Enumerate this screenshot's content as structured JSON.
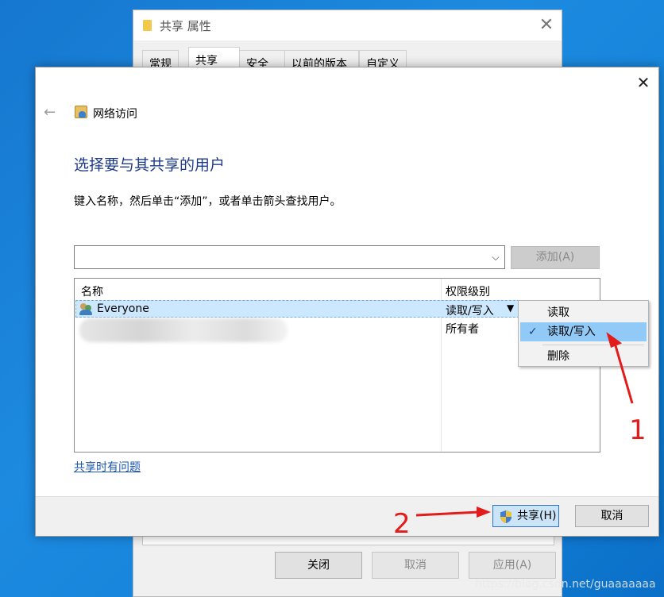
{
  "props_window": {
    "title": "共享 属性",
    "close": "✕",
    "tabs": [
      "常规",
      "共享",
      "安全",
      "以前的版本",
      "自定义"
    ],
    "buttons": {
      "close": "关闭",
      "cancel": "取消",
      "apply": "应用(A)"
    }
  },
  "dialog": {
    "close": "✕",
    "back": "←",
    "caption": "网络访问",
    "heading": "选择要与其共享的用户",
    "instruction": "键入名称，然后单击“添加”，或者单击箭头查找用户。",
    "add_button": "添加(A)",
    "combo_caret": "⌵",
    "columns": {
      "name": "名称",
      "permission": "权限级别"
    },
    "rows": [
      {
        "name": "Everyone",
        "permission": "读取/写入",
        "dropdown": "▼"
      },
      {
        "name": "",
        "permission": "所有者"
      }
    ],
    "help_link": "共享时有问题",
    "share_button": "共享(H)",
    "cancel_button": "取消"
  },
  "context_menu": {
    "items": [
      "读取",
      "读取/写入",
      "删除"
    ],
    "checked": "✓"
  },
  "annotations": {
    "one": "1",
    "two": "2"
  },
  "watermark": "https://blog.csdn.net/guaaaaaaa",
  "colors": {
    "accent": "#1e3a8a",
    "annotation": "#e31b1b",
    "selection": "#91c9f7"
  }
}
